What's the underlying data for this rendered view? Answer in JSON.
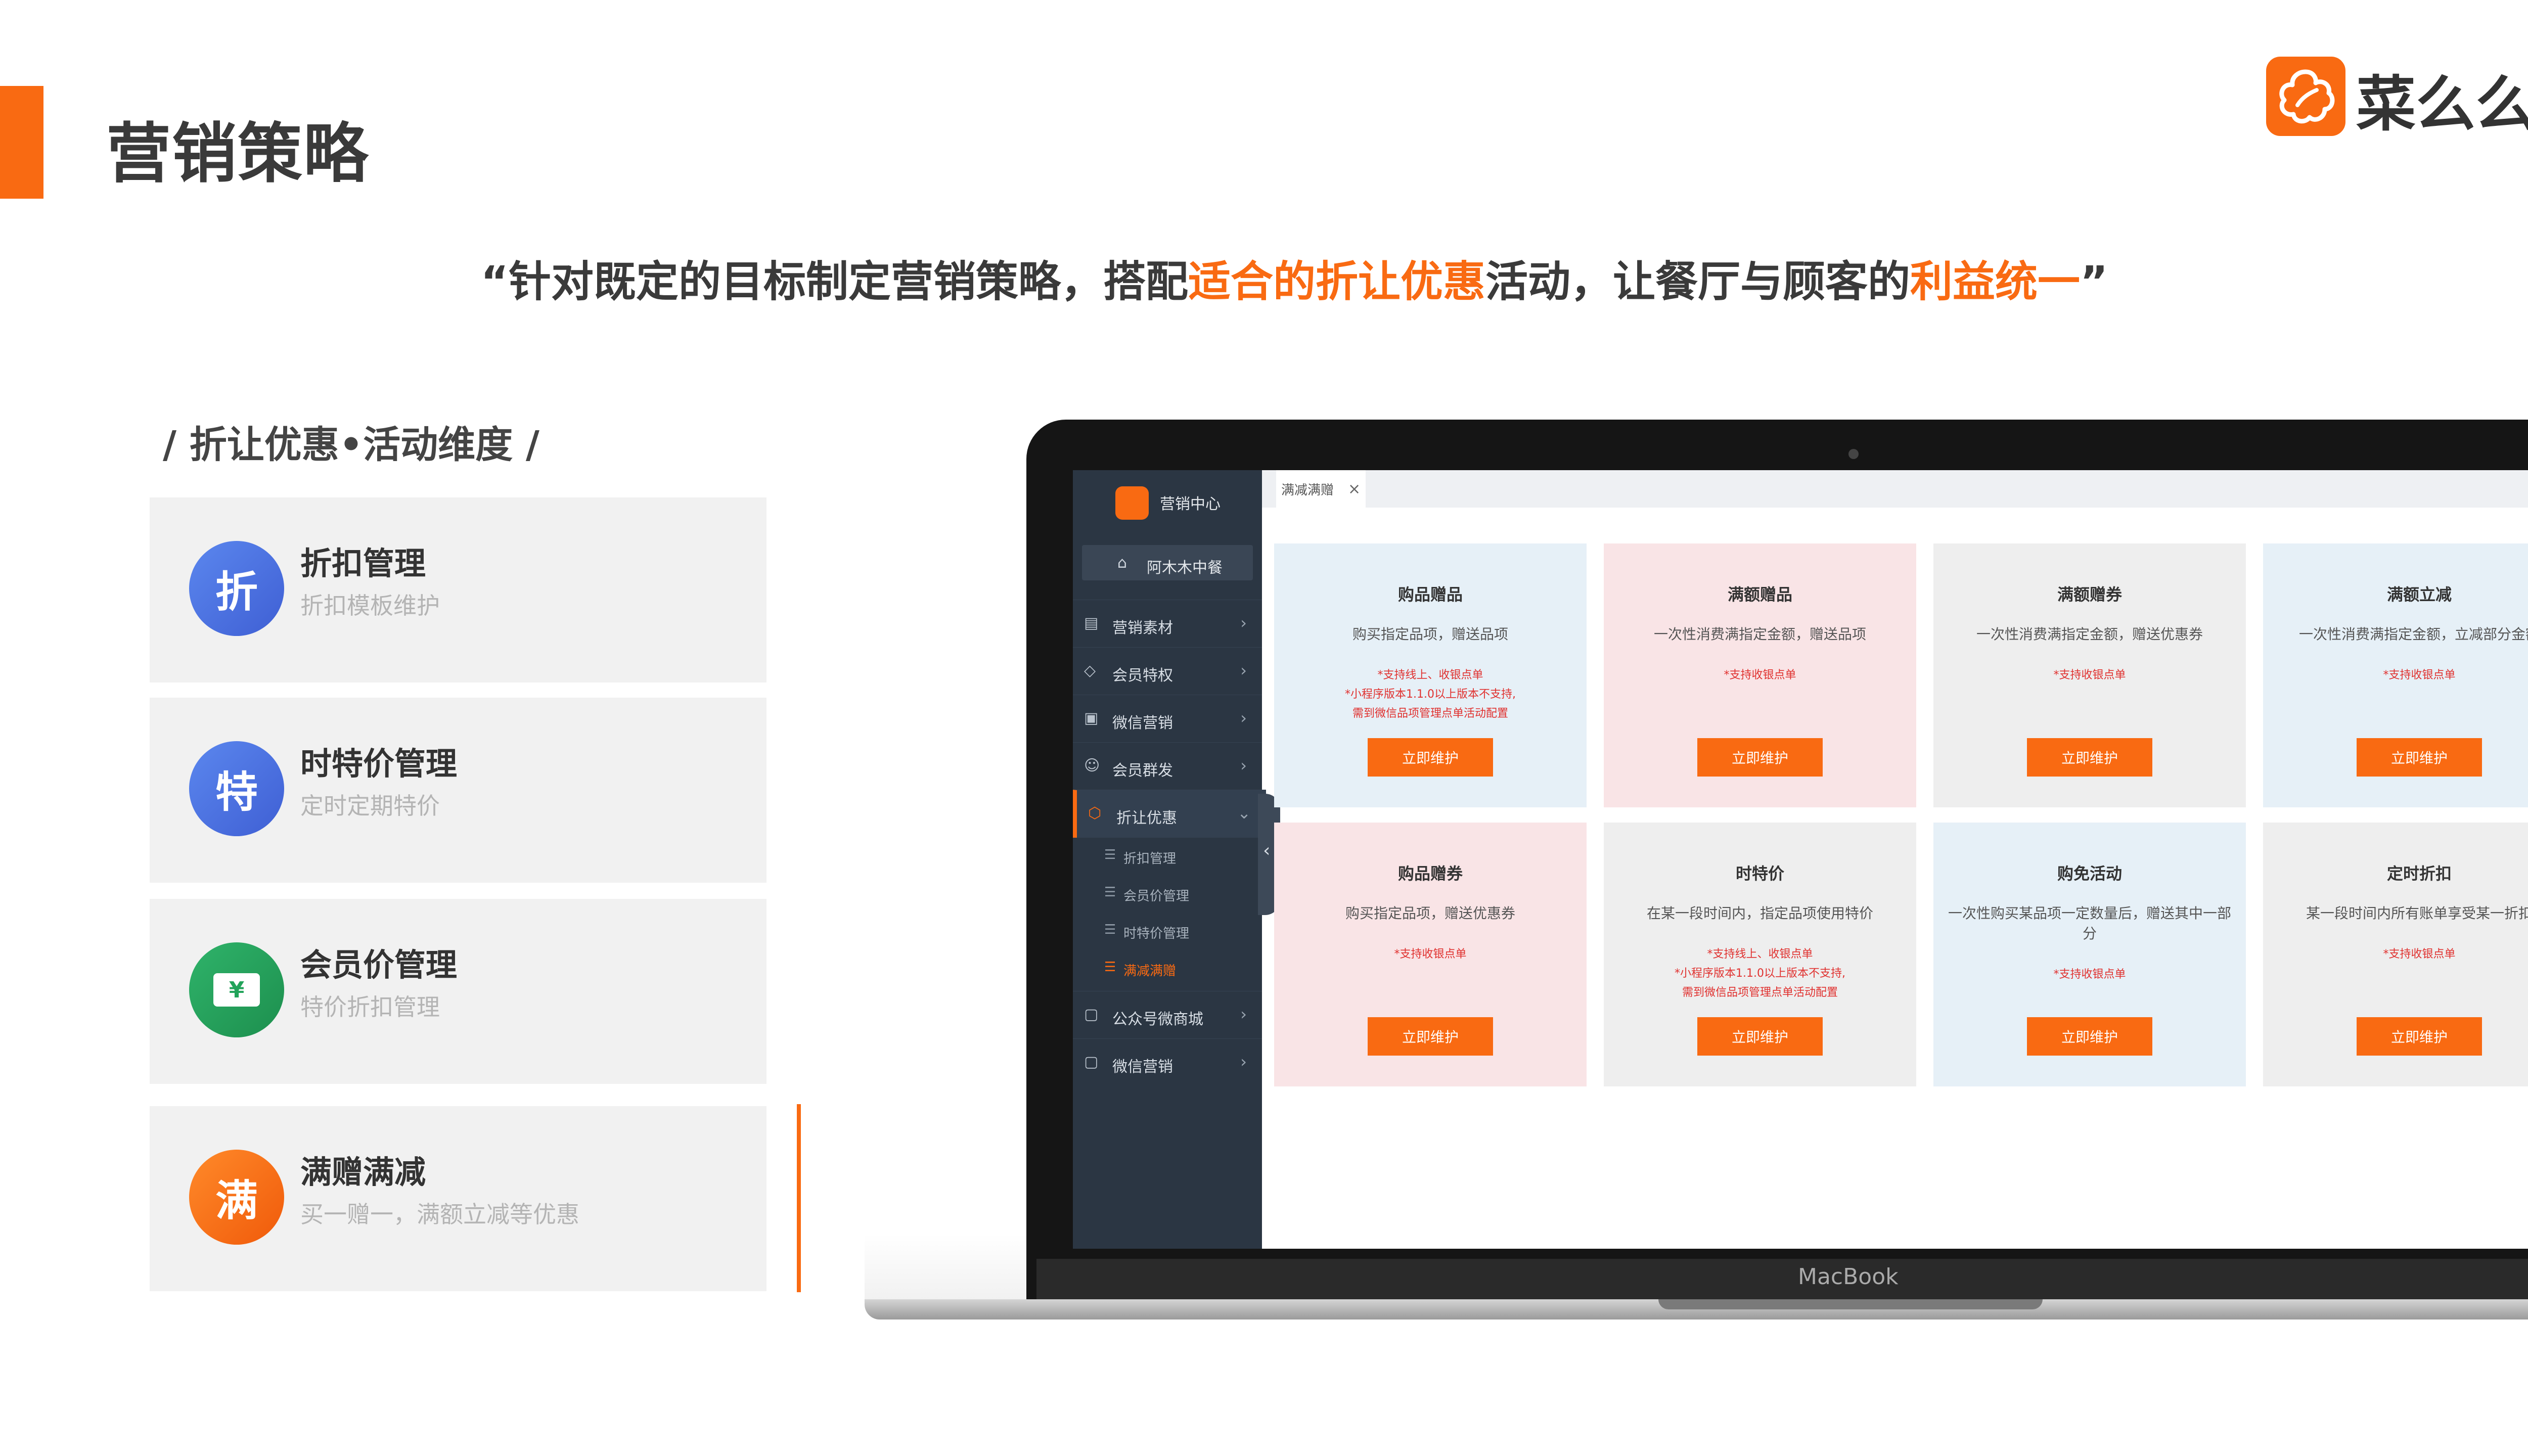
{
  "header": {
    "title": "营销策略",
    "brand_name": "菜么么",
    "quote": {
      "part1": "“针对既定的目标制定营销策略，搭配",
      "highlight1": "适合的折让优惠",
      "part2": "活动，让餐厅与顾客的",
      "highlight2": "利益统一",
      "part3": "”"
    }
  },
  "features": {
    "section_label": "/ 折让优惠•活动维度 /",
    "items": [
      {
        "badge": "折",
        "title": "折扣管理",
        "desc": "折扣模板维护"
      },
      {
        "badge": "特",
        "title": "时特价管理",
        "desc": "定时定期特价"
      },
      {
        "badge": "¥",
        "title": "会员价管理",
        "desc": "特价折扣管理"
      },
      {
        "badge": "满",
        "title": "满赠满减",
        "desc": "买一赠一，满额立减等优惠"
      }
    ]
  },
  "laptop": {
    "label": "MacBook"
  },
  "app": {
    "sidebar": {
      "title": "营销中心",
      "store": "阿木木中餐",
      "items": [
        {
          "label": "营销素材",
          "icon": "document-icon"
        },
        {
          "label": "会员特权",
          "icon": "diamond-icon"
        },
        {
          "label": "微信营销",
          "icon": "gift-icon"
        },
        {
          "label": "会员群发",
          "icon": "users-icon"
        },
        {
          "label": "折让优惠",
          "icon": "tag-icon"
        }
      ],
      "subitems": [
        "折扣管理",
        "会员价管理",
        "时特价管理",
        "满减满赠"
      ],
      "items_after": [
        {
          "label": "公众号微商城",
          "icon": "shop-icon"
        },
        {
          "label": "微信营销",
          "icon": "chat-icon"
        }
      ]
    },
    "tab": {
      "label": "满减满赠"
    },
    "cards": [
      {
        "title": "购品赠品",
        "desc": "购买指定品项，赠送品项",
        "notes": [
          "*支持线上、收银点单",
          "*小程序版本1.1.0以上版本不支持,",
          "需到微信品项管理点单活动配置"
        ],
        "button": "立即维护",
        "color": "blue"
      },
      {
        "title": "满额赠品",
        "desc": "一次性消费满指定金额，赠送品项",
        "notes": [
          "*支持收银点单"
        ],
        "button": "立即维护",
        "color": "pink"
      },
      {
        "title": "满额赠券",
        "desc": "一次性消费满指定金额，赠送优惠券",
        "notes": [
          "*支持收银点单"
        ],
        "button": "立即维护",
        "color": "gray"
      },
      {
        "title": "满额立减",
        "desc": "一次性消费满指定金额，立减部分金额",
        "notes": [
          "*支持收银点单"
        ],
        "button": "立即维护",
        "color": "blue"
      },
      {
        "title": "购品赠券",
        "desc": "购买指定品项，赠送优惠券",
        "notes": [
          "*支持收银点单"
        ],
        "button": "立即维护",
        "color": "pink"
      },
      {
        "title": "时特价",
        "desc": "在某一段时间内，指定品项使用特价",
        "notes": [
          "*支持线上、收银点单",
          "*小程序版本1.1.0以上版本不支持,",
          "需到微信品项管理点单活动配置"
        ],
        "button": "立即维护",
        "color": "gray"
      },
      {
        "title": "购免活动",
        "desc": "一次性购买某品项一定数量后，赠送其中一部分",
        "notes": [
          "*支持收银点单"
        ],
        "button": "立即维护",
        "color": "blue"
      },
      {
        "title": "定时折扣",
        "desc": "某一段时间内所有账单享受某一折扣",
        "notes": [
          "*支持收银点单"
        ],
        "button": "立即维护",
        "color": "gray"
      }
    ]
  },
  "colors": {
    "accent": "#f96a12",
    "badge_zhe": "#4a6fe0",
    "badge_te": "#4a6fe0",
    "badge_yuan": "#22a35a",
    "badge_man": "#f96a12",
    "note_red": "#e0312f"
  }
}
